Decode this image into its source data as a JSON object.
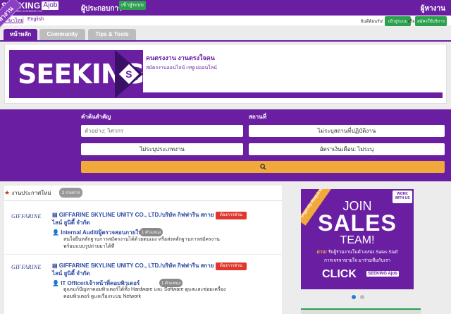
{
  "header": {
    "logo_text": "SEEKING",
    "logo_ajob": "Ajob",
    "logo_tagline": "WHAT YOU SEEK IS SEEKING YOU",
    "employer": "ผู้ประกอบการ",
    "employer_login": "เข้าสู่ระบบ",
    "jobseeker": "ผู้หางาน"
  },
  "lang": {
    "thai": "ภาษาไทย",
    "separator": "|",
    "english": "English"
  },
  "account": {
    "welcome": "ยินดีต้อนรับ!",
    "login": "เข้าสู่ระบบ",
    "or": "หรือ",
    "register": "สมัครใช้บริการ"
  },
  "tabs": [
    "หน้าหลัก",
    "Community",
    "Tips & Tools"
  ],
  "banner": {
    "logo": "SEEKING",
    "logo_s": "S",
    "headline": "คนตรงงาน งานตรงใจคน",
    "subline": "สมัครงานออนไลน์ เรซูเม่ออนไลน์"
  },
  "search": {
    "ribbon": "ค้นหางาน",
    "keyword_label": "คำค้นสำคัญ",
    "location_label": "สถานที่",
    "keyword_placeholder": "ตัวอย่าง: วิศวกร",
    "location_value": "ไม่ระบุสถานที่ปฏิบัติงาน",
    "type_value": "ไม่ระบุประเภทงาน",
    "salary_value": "อัตราเงินเดือน: ไม่ระบุ"
  },
  "jobs": {
    "heading": "งานประกาศใหม่",
    "count": "2 รายการ",
    "items": [
      {
        "company_logo": "GIFFARINE",
        "company": "GIFFARINE SKYLINE UNITY CO., LTD./บริษัท กิฟฟารีน สกายไลน์ ยูนิตี้ จำกัด",
        "urgent": "ต้องการด่วน",
        "position": "Internal Audit/ผู้ตรวจสอบภายใน",
        "positions_count": "1 ตำแหน่ง",
        "description": "สนใจยื่นหลักฐานการสมัครงานได้ด้วยตนเอง หรือส่งหลักฐานการสมัครงานพร้อมแบบรูปถ่ายมาได้ที่"
      },
      {
        "company_logo": "GIFFARINE",
        "company": "GIFFARINE SKYLINE UNITY CO., LTD./บริษัท กิฟฟารีน สกายไลน์ ยูนิตี้ จำกัด",
        "urgent": "ต้องการด่วน",
        "position": "IT Officer/เจ้าหน้าที่คอมพิวเตอร์",
        "positions_count": "1 ตำแหน่ง",
        "description": "ดูแลแก้ปัญหาคอมพิวเตอร์ได้ทั้ง Hardware และ Software ดูแลและซ่อมเครื่องคอมพิวเตอร์ ดูแลเรื่องระบบ Network"
      }
    ]
  },
  "ad": {
    "urgent": "Urgently Required !!",
    "work": "WORK WITH US",
    "join": "JOIN",
    "sales": "SALES",
    "team": "TEAM!",
    "line1_prefix": "ด่วน!",
    "line1": "รับผู้ร่วมงานในตำแหน่ง Sales Staff",
    "line2": "การเจรจาขายใจ มาร่วมทีมกับเรา",
    "click": "CLICK",
    "logo": "SEEKING Ajob"
  }
}
